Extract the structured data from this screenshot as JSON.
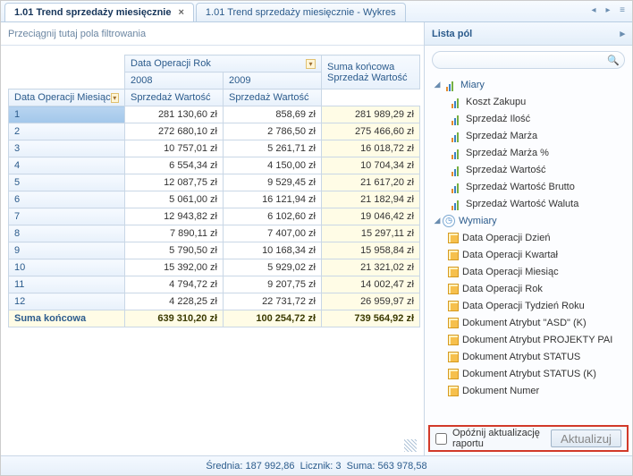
{
  "tabs": [
    {
      "label": "1.01 Trend sprzedaży miesięcznie",
      "active": true,
      "closable": true
    },
    {
      "label": "1.01 Trend sprzedaży miesięcznie - Wykres",
      "active": false,
      "closable": false
    }
  ],
  "filter_hint": "Przeciągnij tutaj pola filtrowania",
  "pivot": {
    "col_field_label": "Data Operacji Rok",
    "row_field_label": "Data Operacji Miesiąc",
    "columns": [
      "2008",
      "2009"
    ],
    "value_label": "Sprzedaż Wartość",
    "grand_col_label": "Suma końcowa",
    "grand_row_label": "Suma końcowa",
    "rows": [
      {
        "m": "1",
        "v": [
          "281 130,60 zł",
          "858,69 zł"
        ],
        "t": "281 989,29 zł"
      },
      {
        "m": "2",
        "v": [
          "272 680,10 zł",
          "2 786,50 zł"
        ],
        "t": "275 466,60 zł"
      },
      {
        "m": "3",
        "v": [
          "10 757,01 zł",
          "5 261,71 zł"
        ],
        "t": "16 018,72 zł"
      },
      {
        "m": "4",
        "v": [
          "6 554,34 zł",
          "4 150,00 zł"
        ],
        "t": "10 704,34 zł"
      },
      {
        "m": "5",
        "v": [
          "12 087,75 zł",
          "9 529,45 zł"
        ],
        "t": "21 617,20 zł"
      },
      {
        "m": "6",
        "v": [
          "5 061,00 zł",
          "16 121,94 zł"
        ],
        "t": "21 182,94 zł"
      },
      {
        "m": "7",
        "v": [
          "12 943,82 zł",
          "6 102,60 zł"
        ],
        "t": "19 046,42 zł"
      },
      {
        "m": "8",
        "v": [
          "7 890,11 zł",
          "7 407,00 zł"
        ],
        "t": "15 297,11 zł"
      },
      {
        "m": "9",
        "v": [
          "5 790,50 zł",
          "10 168,34 zł"
        ],
        "t": "15 958,84 zł"
      },
      {
        "m": "10",
        "v": [
          "15 392,00 zł",
          "5 929,02 zł"
        ],
        "t": "21 321,02 zł"
      },
      {
        "m": "11",
        "v": [
          "4 794,72 zł",
          "9 207,75 zł"
        ],
        "t": "14 002,47 zł"
      },
      {
        "m": "12",
        "v": [
          "4 228,25 zł",
          "22 731,72 zł"
        ],
        "t": "26 959,97 zł"
      }
    ],
    "grand_row": {
      "v": [
        "639 310,20 zł",
        "100 254,72 zł"
      ],
      "t": "739 564,92 zł"
    }
  },
  "field_list": {
    "title": "Lista pól",
    "search_placeholder": "",
    "groups": [
      {
        "label": "Miary",
        "kind": "measure",
        "items": [
          "Koszt Zakupu",
          "Sprzedaż Ilość",
          "Sprzedaż Marża",
          "Sprzedaż Marża %",
          "Sprzedaż Wartość",
          "Sprzedaż Wartość Brutto",
          "Sprzedaż Wartość Waluta"
        ]
      },
      {
        "label": "Wymiary",
        "kind": "dimension",
        "items": [
          "Data Operacji Dzień",
          "Data Operacji Kwartał",
          "Data Operacji Miesiąc",
          "Data Operacji Rok",
          "Data Operacji Tydzień Roku",
          "Dokument Atrybut \"ASD\" (K)",
          "Dokument Atrybut PROJEKTY PAI",
          "Dokument Atrybut STATUS",
          "Dokument Atrybut STATUS (K)",
          "Dokument Numer"
        ]
      }
    ],
    "defer_label": "Opóźnij aktualizację raportu",
    "refresh_label": "Aktualizuj"
  },
  "status": {
    "avg_label": "Średnia",
    "avg_value": "187 992,86",
    "count_label": "Licznik",
    "count_value": "3",
    "sum_label": "Suma",
    "sum_value": "563 978,58"
  }
}
